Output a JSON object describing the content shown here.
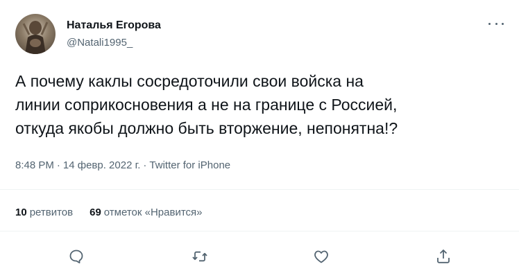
{
  "author": {
    "name": "Наталья Егорова",
    "handle": "@Natali1995_"
  },
  "tweet": {
    "lines": [
      "А почему каклы сосредоточили свои войска на",
      "линии соприкосновения а не на границе с Россией,",
      "откуда якобы должно быть вторжение, непонятна!?"
    ],
    "time": "8:48 PM",
    "date": "14 февр. 2022 г.",
    "source": "Twitter for iPhone",
    "separator": "·"
  },
  "stats": {
    "retweets_count": "10",
    "retweets_label": "ретвитов",
    "likes_count": "69",
    "likes_label": "отметок «Нравится»"
  },
  "colors": {
    "text": "#0f1419",
    "secondary": "#536471",
    "divider": "#eff3f4"
  },
  "icons": [
    "more-icon",
    "reply-icon",
    "retweet-icon",
    "like-icon",
    "share-icon"
  ]
}
